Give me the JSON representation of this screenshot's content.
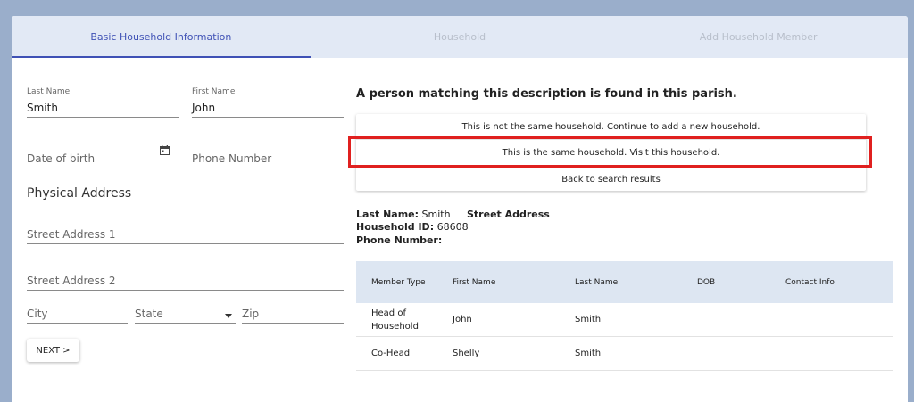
{
  "stepper": {
    "steps": [
      {
        "label": "Basic Household Information",
        "active": true
      },
      {
        "label": "Household",
        "active": false
      },
      {
        "label": "Add Household Member",
        "active": false
      }
    ]
  },
  "form": {
    "last_name_label": "Last Name",
    "last_name_value": "Smith",
    "first_name_label": "First Name",
    "first_name_value": "John",
    "dob_placeholder": "Date of birth",
    "phone_placeholder": "Phone Number",
    "physical_address_title": "Physical Address",
    "street1_placeholder": "Street Address 1",
    "street2_placeholder": "Street Address 2",
    "city_placeholder": "City",
    "state_placeholder": "State",
    "zip_placeholder": "Zip",
    "next_label": "NEXT >"
  },
  "match": {
    "title": "A person matching this description is found in this parish.",
    "options": [
      "This is not the same household. Continue to add a new household.",
      "This is the same household. Visit this household.",
      "Back to search results"
    ]
  },
  "household": {
    "last_name_label": "Last Name:",
    "last_name_value": "Smith",
    "street_address_label": "Street Address",
    "household_id_label": "Household ID:",
    "household_id_value": "68608",
    "phone_label": "Phone Number:"
  },
  "members": {
    "headers": [
      "Member Type",
      "First Name",
      "Last Name",
      "DOB",
      "Contact Info"
    ],
    "rows": [
      {
        "type": "Head of Household",
        "first": "John",
        "last": "Smith",
        "dob": "",
        "contact": ""
      },
      {
        "type": "Co-Head",
        "first": "Shelly",
        "last": "Smith",
        "dob": "",
        "contact": ""
      }
    ]
  },
  "colors": {
    "accent": "#3f51b5",
    "highlight": "#e0201f",
    "header_bg": "#e2e9f5",
    "page_bg": "#9aaecb"
  }
}
